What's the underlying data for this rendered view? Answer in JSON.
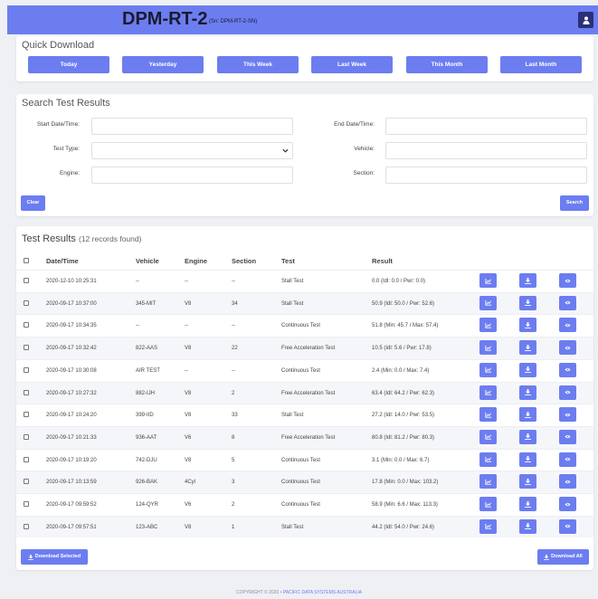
{
  "header": {
    "title": "DPM-RT-2",
    "serial": "(Sn: DPM-RT-2-SN)",
    "user_icon": "user-icon"
  },
  "quick_download": {
    "title": "Quick Download",
    "buttons": [
      "Today",
      "Yesterday",
      "This Week",
      "Last Week",
      "This Month",
      "Last Month"
    ]
  },
  "search": {
    "title": "Search Test Results",
    "start_label": "Start Date/Time:",
    "end_label": "End Date/Time:",
    "type_label": "Test Type:",
    "vehicle_label": "Vehicle:",
    "engine_label": "Engine:",
    "section_label": "Section:",
    "clear_label": "Clear",
    "search_label": "Search"
  },
  "results": {
    "title": "Test Results",
    "count_text": "(12 records found)",
    "columns": [
      "Date/Time",
      "Vehicle",
      "Engine",
      "Section",
      "Test",
      "Result"
    ],
    "rows": [
      [
        "2020-12-10 10:25:31",
        "--",
        "--",
        "--",
        "Stall Test",
        "0.0 (Idl: 0.0 / Pwr: 0.0)"
      ],
      [
        "2020-09-17 10:37:00",
        "345-MIT",
        "V8",
        "34",
        "Stall Test",
        "50.9 (Idl: 50.0 / Pwr: 52.6)"
      ],
      [
        "2020-09-17 10:34:35",
        "--",
        "--",
        "--",
        "Continuous Test",
        "51.8 (Min: 45.7 / Max: 57.4)"
      ],
      [
        "2020-09-17 10:32:42",
        "822-AAS",
        "V8",
        "22",
        "Free Acceleration Test",
        "10.5 (Idl: 5.6 / Pwr: 17.8)"
      ],
      [
        "2020-09-17 10:30:08",
        "AIR TEST",
        "--",
        "--",
        "Continuous Test",
        "2.4 (Min: 0.0 / Max: 7.4)"
      ],
      [
        "2020-09-17 10:27:32",
        "882-IJH",
        "V8",
        "2",
        "Free Acceleration Test",
        "63.4 (Idl: 64.2 / Pwr: 62.3)"
      ],
      [
        "2020-09-17 10:24:20",
        "399-IID",
        "V8",
        "33",
        "Stall Test",
        "27.2 (Idl: 14.0 / Pwr: 53.5)"
      ],
      [
        "2020-09-17 10:21:33",
        "936-AAT",
        "V6",
        "8",
        "Free Acceleration Test",
        "80.8 (Idl: 81.2 / Pwr: 80.3)"
      ],
      [
        "2020-09-17 10:19:20",
        "742-DJU",
        "V8",
        "5",
        "Continuous Test",
        "3.1 (Min: 0.0 / Max: 6.7)"
      ],
      [
        "2020-09-17 10:13:59",
        "926-BAK",
        "4Cyl",
        "3",
        "Continuous Test",
        "17.8 (Min: 0.0 / Max: 103.2)"
      ],
      [
        "2020-09-17 09:59:52",
        "124-QYR",
        "V6",
        "2",
        "Continuous Test",
        "58.9 (Min: 6.6 / Max: 113.3)"
      ],
      [
        "2020-09-17 09:57:51",
        "123-ABC",
        "V8",
        "1",
        "Stall Test",
        "44.2 (Idl: 54.0 / Pwr: 24.6)"
      ]
    ],
    "action_icons": [
      "chart-icon",
      "download-icon",
      "eye-icon"
    ],
    "download_selected": "Download Selected",
    "download_all": "Download All"
  },
  "footer": {
    "copyright": "COPYRIGHT © 2020 •",
    "company": "PACIFIC DATA SYSTEMS AUSTRALIA"
  },
  "colors": {
    "accent": "#6c7df0",
    "user_button": "#2a2f7a"
  }
}
